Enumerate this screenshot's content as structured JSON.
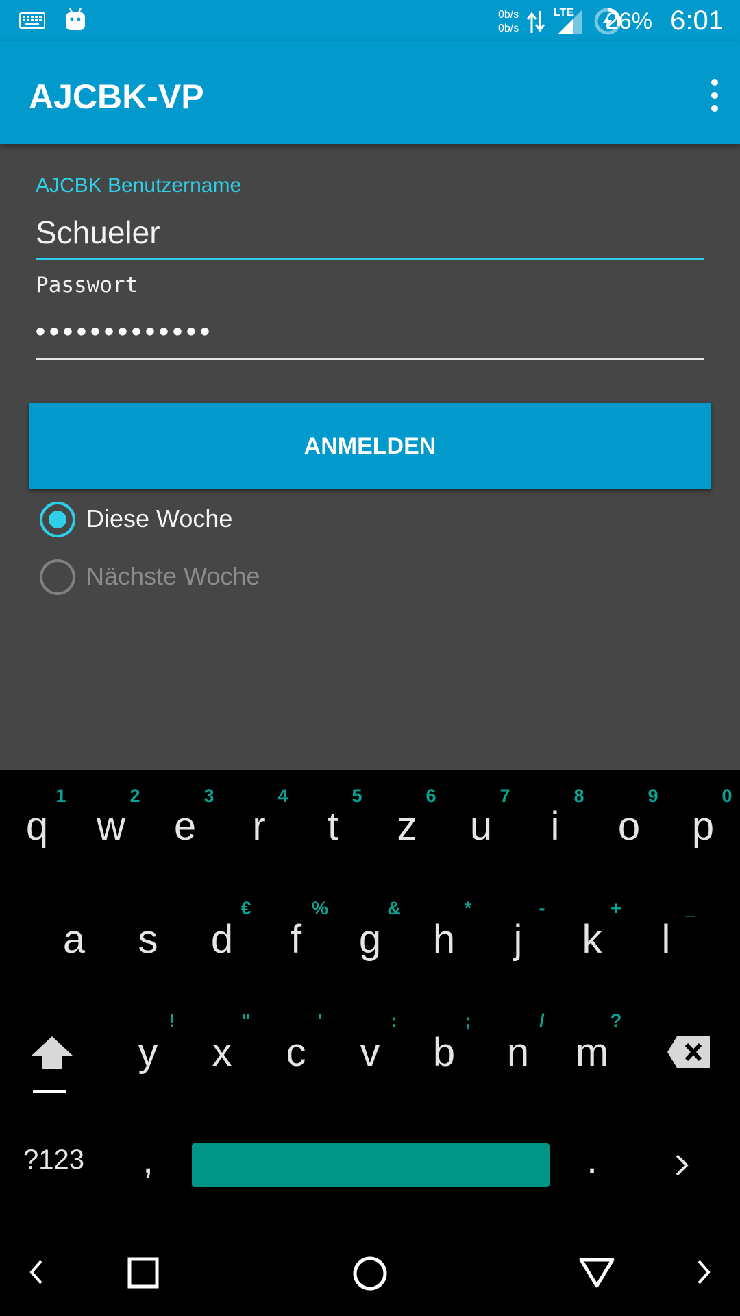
{
  "status_bar": {
    "net_up": "0b/s",
    "net_down": "0b/s",
    "network_type": "LTE",
    "battery_percent": "26%",
    "time": "6:01",
    "icons": [
      "keyboard-icon",
      "android-icon",
      "data-arrows-icon",
      "signal-icon",
      "battery-charging-icon"
    ]
  },
  "app_bar": {
    "title": "AJCBK-VP",
    "menu_icon": "overflow-menu-icon"
  },
  "form": {
    "username_label": "AJCBK Benutzername",
    "username_value": "Schueler",
    "password_label": "Passwort",
    "password_value": "•••••••••••••",
    "login_button": "ANMELDEN",
    "options": [
      {
        "label": "Diese Woche",
        "checked": true
      },
      {
        "label": "Nächste Woche",
        "checked": false
      }
    ]
  },
  "keyboard": {
    "row1": [
      "q",
      "w",
      "e",
      "r",
      "t",
      "z",
      "u",
      "i",
      "o",
      "p"
    ],
    "row1_hints": [
      "1",
      "2",
      "3",
      "4",
      "5",
      "6",
      "7",
      "8",
      "9",
      "0"
    ],
    "row2": [
      "a",
      "s",
      "d",
      "f",
      "g",
      "h",
      "j",
      "k",
      "l"
    ],
    "row2_hints": [
      "",
      "",
      "€",
      "%",
      "&",
      "*",
      "-",
      "+",
      "_"
    ],
    "row3": [
      "y",
      "x",
      "c",
      "v",
      "b",
      "n",
      "m"
    ],
    "row3_hints": [
      "!",
      "\"",
      "'",
      ":",
      ";",
      "/",
      "?"
    ],
    "symbols_key": "?123",
    "comma": ",",
    "period": ".",
    "accent_color": "#009587"
  },
  "colors": {
    "primary": "#0299cc",
    "accent": "#2ecfe9",
    "background": "#464646"
  }
}
